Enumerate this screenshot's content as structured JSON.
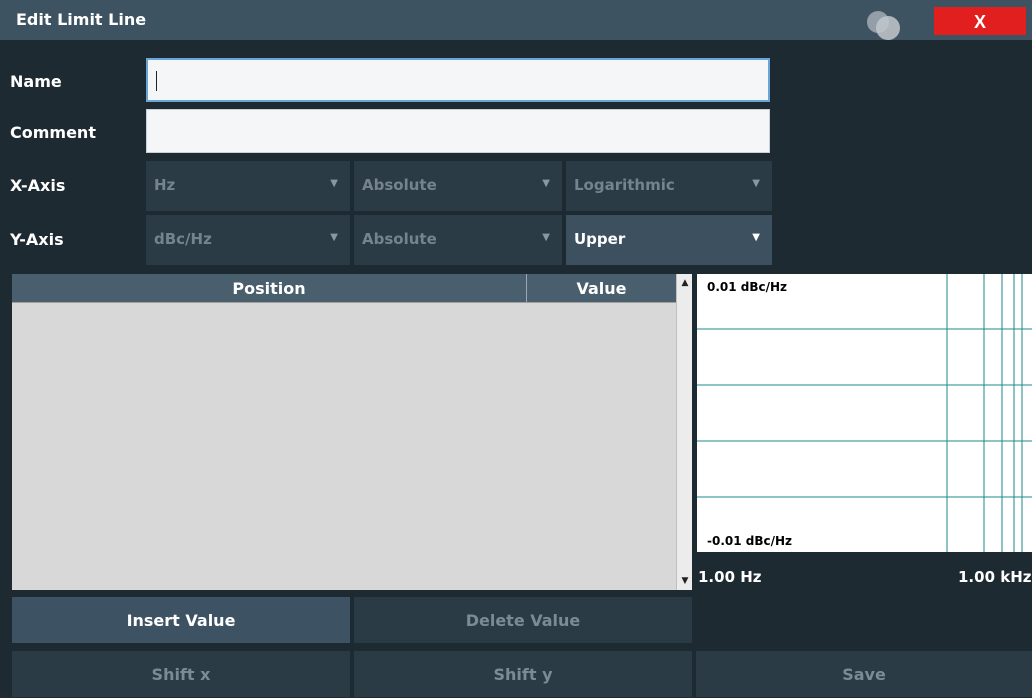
{
  "dialog": {
    "title": "Edit Limit Line",
    "close_label": "X"
  },
  "form": {
    "name_label": "Name",
    "name_value": "",
    "comment_label": "Comment",
    "comment_value": "",
    "x_axis_label": "X-Axis",
    "y_axis_label": "Y-Axis",
    "x_unit": "Hz",
    "x_scaling": "Absolute",
    "x_spacing": "Logarithmic",
    "y_unit": "dBc/Hz",
    "y_scaling": "Absolute",
    "y_limit_type": "Upper"
  },
  "table": {
    "columns": [
      "Position",
      "Value"
    ],
    "rows": []
  },
  "preview": {
    "y_top_label": "0.01 dBc/Hz",
    "y_bottom_label": "-0.01 dBc/Hz",
    "x_start_label": "1.00 Hz",
    "x_stop_label": "1.00 kHz",
    "line_color": "#1e8a8a"
  },
  "buttons": {
    "insert_value": "Insert Value",
    "delete_value": "Delete Value",
    "shift_x": "Shift x",
    "shift_y": "Shift y",
    "save": "Save"
  },
  "colors": {
    "title_bar": "#3e5362",
    "close_button": "#e11f1f",
    "background": "#1e2a32"
  },
  "icons": {
    "title_icon": "overlapping-circles-icon",
    "close_icon": "close-icon",
    "dropdown_icon": "chevron-down-icon",
    "scroll_up_icon": "scroll-up-icon",
    "scroll_down_icon": "scroll-down-icon"
  }
}
